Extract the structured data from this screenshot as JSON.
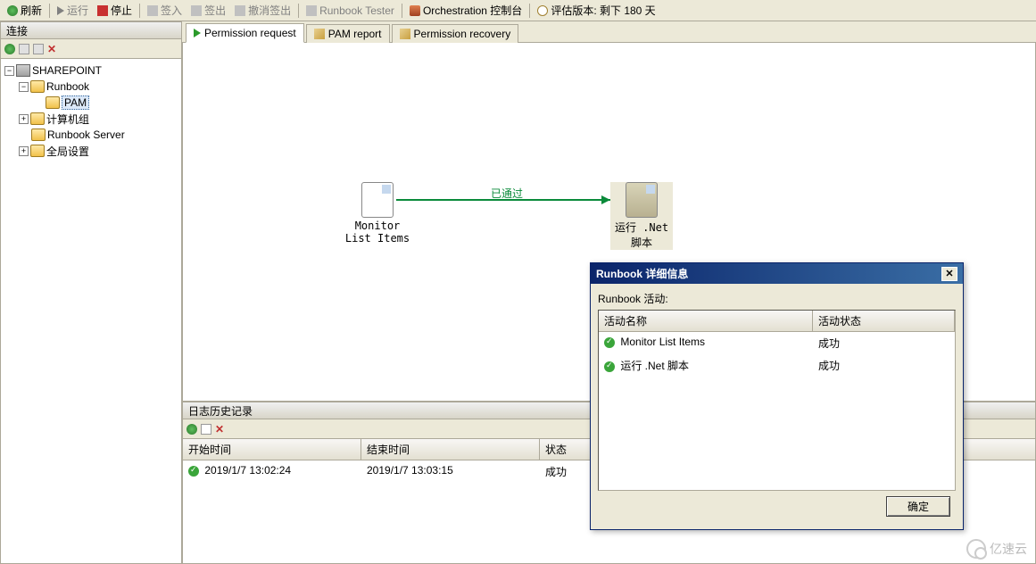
{
  "toolbar": {
    "refresh": "刷新",
    "run": "运行",
    "stop": "停止",
    "checkin": "签入",
    "checkout": "签出",
    "undo_checkout": "撤消签出",
    "runbook_tester": "Runbook Tester",
    "orchestration_console": "Orchestration 控制台",
    "eval_version": "评估版本: 剩下 180 天"
  },
  "left_panel": {
    "title": "连接",
    "tree": {
      "root": "SHAREPOINT",
      "runbook": "Runbook",
      "pam": "PAM",
      "computer_groups": "计算机组",
      "runbook_server": "Runbook Server",
      "global_settings": "全局设置"
    }
  },
  "tabs": {
    "permission_request": "Permission request",
    "pam_report": "PAM report",
    "permission_recovery": "Permission recovery"
  },
  "canvas": {
    "activity1_line1": "Monitor",
    "activity1_line2": "List Items",
    "link_label": "已通过",
    "activity2_line1": "运行 .Net",
    "activity2_line2": "脚本"
  },
  "log": {
    "title": "日志历史记录",
    "col_start": "开始时间",
    "col_end": "结束时间",
    "col_status": "状态",
    "row_start": "2019/1/7 13:02:24",
    "row_end": "2019/1/7 13:03:15",
    "row_status": "成功"
  },
  "dialog": {
    "title": "Runbook 详细信息",
    "section": "Runbook 活动:",
    "col_name": "活动名称",
    "col_status": "活动状态",
    "rows": [
      {
        "name": "Monitor List Items",
        "status": "成功"
      },
      {
        "name": "运行 .Net 脚本",
        "status": "成功"
      }
    ],
    "ok": "确定"
  },
  "watermark": "亿速云"
}
